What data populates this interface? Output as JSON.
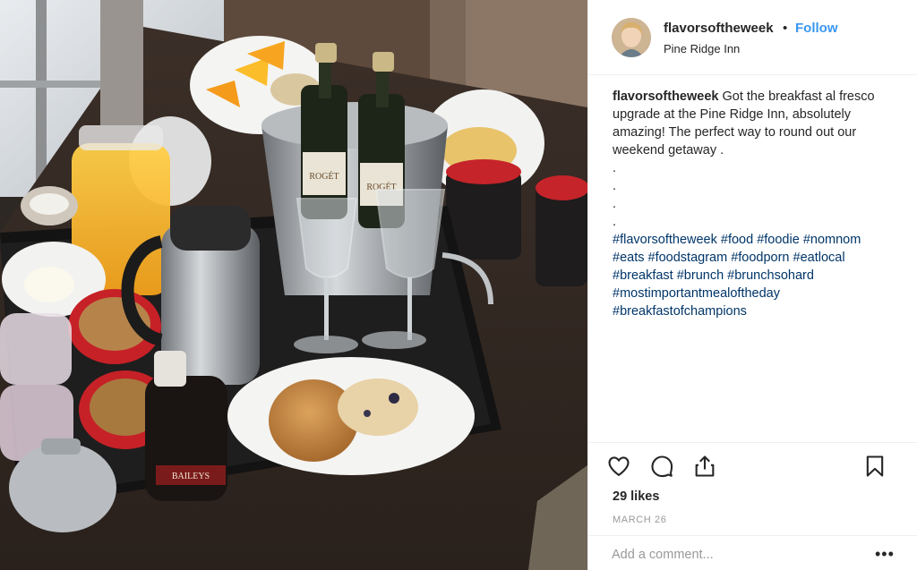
{
  "post": {
    "username": "flavorsoftheweek",
    "separator": "•",
    "follow_label": "Follow",
    "location": "Pine Ridge Inn",
    "caption": {
      "username": "flavorsoftheweek",
      "text": "Got the breakfast al fresco upgrade at the Pine Ridge Inn, absolutely amazing! The perfect way to round out our weekend getaway .",
      "dots": [
        ".",
        ".",
        ".",
        "."
      ],
      "hashtag_lines": [
        "#flavorsoftheweek #food #foodie #nomnom",
        "#eats #foodstagram #foodporn #eatlocal",
        "#breakfast #brunch #brunchsohard",
        "#mostimportantmealoftheday",
        "#breakfastofchampions"
      ]
    },
    "actions": {
      "like_icon": "heart-icon",
      "comment_icon": "comment-icon",
      "share_icon": "share-icon",
      "save_icon": "bookmark-icon"
    },
    "likes": "29 likes",
    "date": "MARCH 26",
    "comment_placeholder": "Add a comment...",
    "more_label": "•••"
  },
  "photo": {
    "label_left": "ROGÉT",
    "label_right": "ROGÉT",
    "label_small": "BAILEYS"
  },
  "colors": {
    "link": "#3897f0",
    "hashtag": "#003569",
    "muted": "#999999",
    "text": "#262626"
  }
}
